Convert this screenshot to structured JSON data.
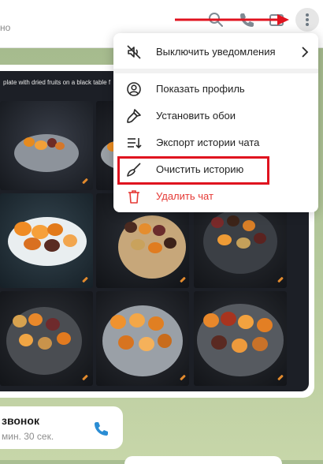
{
  "header": {
    "subtitle": "но",
    "icons": [
      "search-icon",
      "phone-icon",
      "sidebar-toggle-icon",
      "more-vertical-icon"
    ]
  },
  "album": {
    "caption": "plate with dried fruits on a black table f"
  },
  "call": {
    "title": "звонок",
    "duration": "мин. 30 сек."
  },
  "menu": {
    "items": [
      {
        "label": "Выключить уведомления",
        "icon": "mute-icon",
        "has_submenu": true
      },
      {
        "label": "Показать профиль",
        "icon": "profile-icon"
      },
      {
        "label": "Установить обои",
        "icon": "brush-icon"
      },
      {
        "label": "Экспорт истории чата",
        "icon": "export-icon"
      },
      {
        "label": "Очистить историю",
        "icon": "broom-icon",
        "highlighted": true
      },
      {
        "label": "Удалить чат",
        "icon": "trash-icon",
        "danger": true
      }
    ]
  },
  "colors": {
    "accent": "#2b8dd4",
    "danger": "#e53935",
    "annotation": "#e0131f"
  }
}
